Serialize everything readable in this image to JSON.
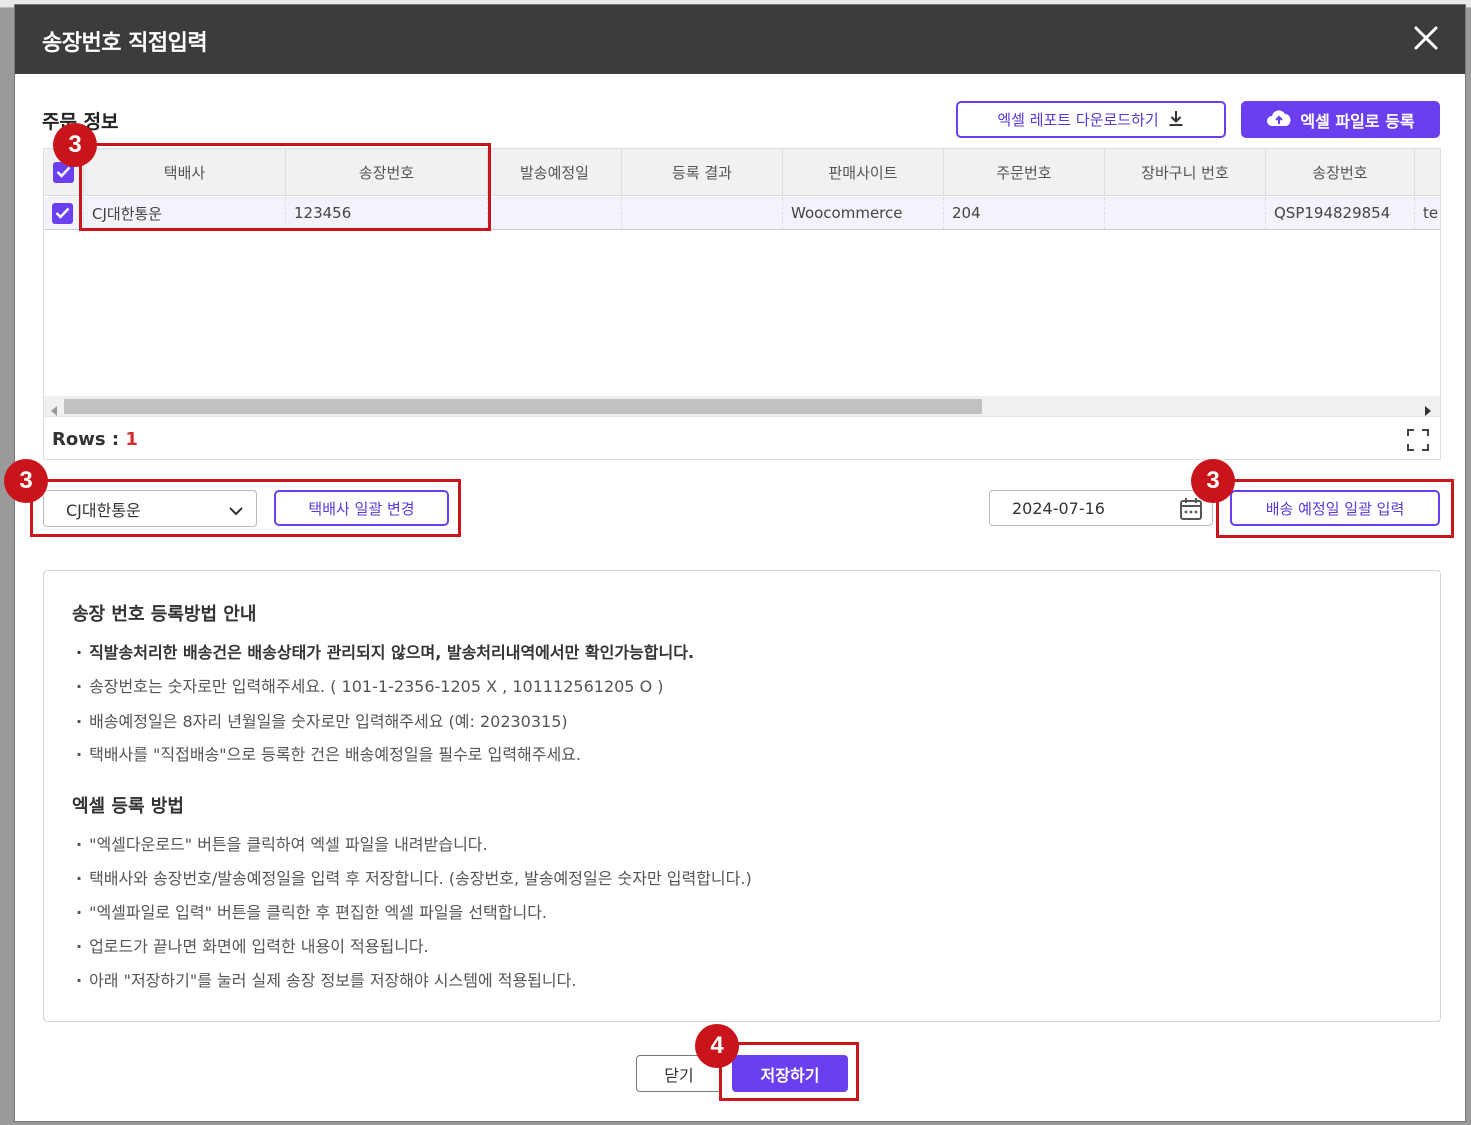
{
  "dialog": {
    "title": "송장번호 직접입력",
    "close_icon": "close-icon"
  },
  "order_info": {
    "title": "주문 정보",
    "excel_report_download_label": "엑셀 레포트 다운로드하기",
    "excel_upload_label": "엑셀 파일로 등록",
    "accent_color": "#6a3ff0"
  },
  "grid": {
    "columns": [
      "택배사",
      "송장번호",
      "발송예정일",
      "등록 결과",
      "판매사이트",
      "주문번호",
      "장바구니 번호",
      "송장번호",
      "te"
    ],
    "rows": [
      {
        "checked": true,
        "courier": "CJ대한통운",
        "tracking_no": "123456",
        "ship_date": "",
        "result": "",
        "site": "Woocommerce",
        "order_no": "204",
        "cart_no": "",
        "tracking_no_2": "QSP194829854",
        "extra": "te"
      }
    ],
    "rows_label": "Rows :",
    "rows_count": "1"
  },
  "bulk_courier": {
    "selected": "CJ대한통운",
    "change_label": "택배사 일괄 변경"
  },
  "bulk_date": {
    "value": "2024-07-16",
    "apply_label": "배송 예정일 일괄 입력"
  },
  "annotations": {
    "badge_3": "3",
    "badge_4": "4",
    "highlight_color": "#c9141b"
  },
  "guide": {
    "title1": "송장 번호 등록방법 안내",
    "items1": [
      "직발송처리한 배송건은 배송상태가 관리되지 않으며, 발송처리내역에서만 확인가능합니다.",
      "송장번호는 숫자로만 입력해주세요. ( 101-1-2356-1205 X , 101112561205 O )",
      "배송예정일은 8자리 년월일을 숫자로만 입력해주세요 (예: 20230315)",
      "택배사를 \"직접배송\"으로 등록한 건은 배송예정일을 필수로 입력해주세요."
    ],
    "title2": "엑셀 등록 방법",
    "items2": [
      "\"엑셀다운로드\" 버튼을 클릭하여 엑셀 파일을 내려받습니다.",
      "택배사와 송장번호/발송예정일을 입력 후 저장합니다. (송장번호, 발송예정일은 숫자만 입력합니다.)",
      "\"엑셀파일로 입력\" 버튼을 클릭한 후 편집한 엑셀 파일을 선택합니다.",
      "업로드가 끝나면 화면에 입력한 내용이 적용됩니다.",
      "아래 \"저장하기\"를 눌러 실제 송장 정보를 저장해야 시스템에 적용됩니다."
    ]
  },
  "footer": {
    "close_label": "닫기",
    "save_label": "저장하기"
  }
}
